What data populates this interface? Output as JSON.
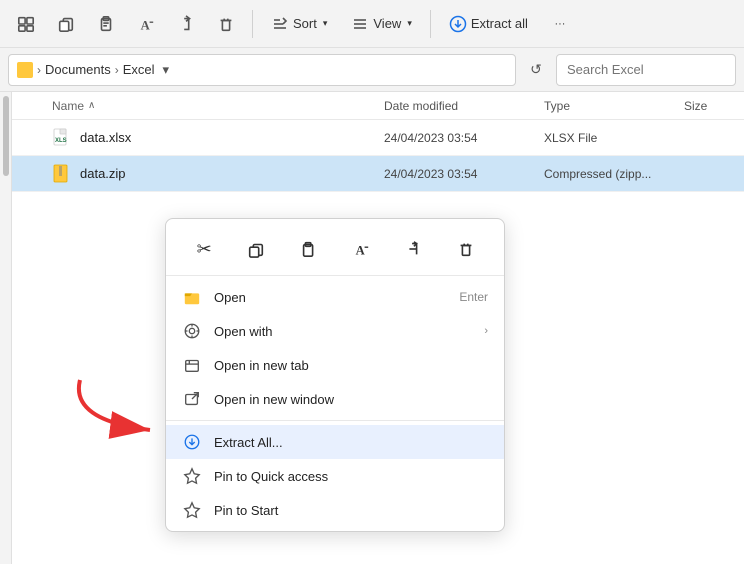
{
  "toolbar": {
    "buttons": [
      {
        "id": "copy-path",
        "icon": "📋",
        "label": ""
      },
      {
        "id": "clipboard",
        "icon": "📋",
        "label": ""
      },
      {
        "id": "format-text",
        "icon": "🅰",
        "label": ""
      },
      {
        "id": "share",
        "icon": "📤",
        "label": ""
      },
      {
        "id": "delete",
        "icon": "🗑",
        "label": ""
      },
      {
        "id": "sort",
        "label": "Sort"
      },
      {
        "id": "view",
        "label": "View"
      },
      {
        "id": "extract",
        "label": "Extract all"
      },
      {
        "id": "more",
        "label": "···"
      }
    ]
  },
  "address": {
    "path": [
      "Documents",
      "Excel"
    ],
    "search_placeholder": "Search Excel"
  },
  "columns": {
    "name": "Name",
    "date_modified": "Date modified",
    "type": "Type",
    "size": "Size"
  },
  "files": [
    {
      "name": "data.xlsx",
      "date": "24/04/2023 03:54",
      "type": "XLSX File",
      "size": ""
    },
    {
      "name": "data.zip",
      "date": "24/04/2023 03:54",
      "type": "Compressed (zipp...",
      "size": ""
    }
  ],
  "context_menu": {
    "icon_bar": [
      {
        "id": "cut",
        "icon": "✂",
        "title": "Cut"
      },
      {
        "id": "copy",
        "icon": "⧉",
        "title": "Copy"
      },
      {
        "id": "paste-shortcut",
        "icon": "📋",
        "title": "Paste shortcut"
      },
      {
        "id": "rename",
        "icon": "🅰",
        "title": "Rename"
      },
      {
        "id": "share-ctx",
        "icon": "↗",
        "title": "Share"
      },
      {
        "id": "delete-ctx",
        "icon": "🗑",
        "title": "Delete"
      }
    ],
    "items": [
      {
        "id": "open",
        "label": "Open",
        "shortcut": "Enter",
        "icon": "📁",
        "has_arrow": false
      },
      {
        "id": "open-with",
        "label": "Open with",
        "shortcut": "",
        "icon": "⚙",
        "has_arrow": true
      },
      {
        "id": "open-new-tab",
        "label": "Open in new tab",
        "shortcut": "",
        "icon": "⬜",
        "has_arrow": false
      },
      {
        "id": "open-new-window",
        "label": "Open in new window",
        "shortcut": "",
        "icon": "⬜",
        "has_arrow": false
      },
      {
        "id": "extract-all",
        "label": "Extract All...",
        "shortcut": "",
        "icon": "📦",
        "has_arrow": false,
        "highlighted": true
      },
      {
        "id": "pin-quick",
        "label": "Pin to Quick access",
        "shortcut": "",
        "icon": "📌",
        "has_arrow": false
      },
      {
        "id": "pin-start",
        "label": "Pin to Start",
        "shortcut": "",
        "icon": "📌",
        "has_arrow": false
      }
    ]
  }
}
